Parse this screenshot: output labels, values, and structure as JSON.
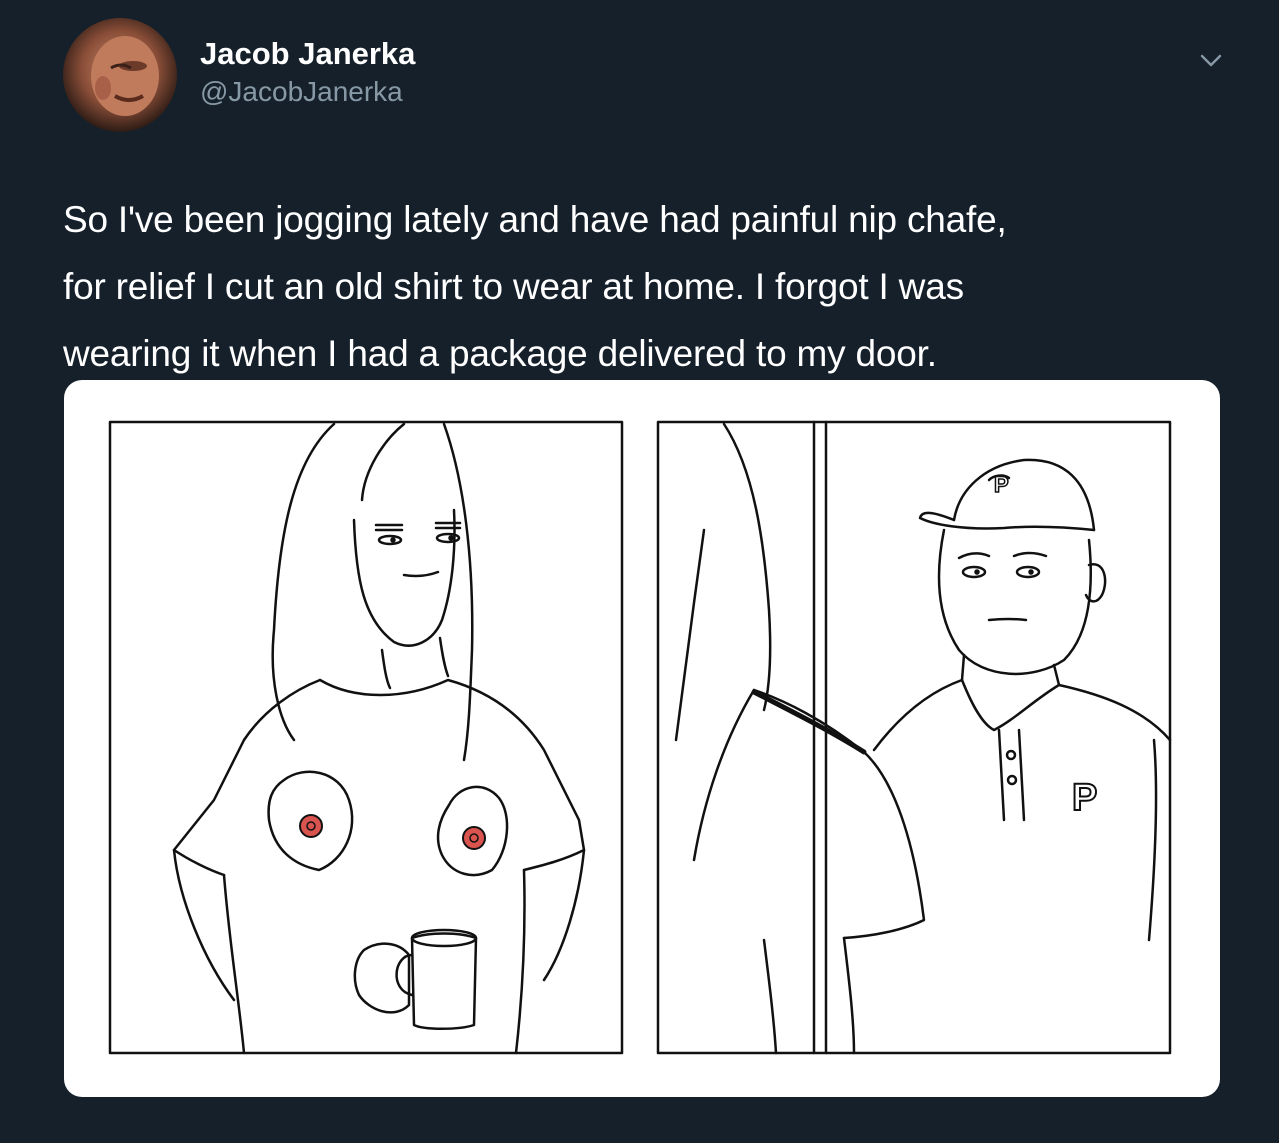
{
  "author": {
    "display_name": "Jacob Janerka",
    "handle": "@JacobJanerka",
    "avatar_icon": "profile-photo"
  },
  "tweet": {
    "text_lines": [
      "So I've been jogging lately and have had painful nip chafe,",
      "for relief I cut an old shirt to wear at home.  I forgot I was",
      "wearing it when I had a package delivered to my door."
    ]
  },
  "menu": {
    "icon": "chevron-down-icon"
  },
  "media": {
    "type": "two-panel comic",
    "cap_letter": "P",
    "shirt_letter": "P"
  },
  "colors": {
    "background": "#15202b",
    "handle_text": "#8899a6",
    "nipple": "#d9534f"
  }
}
